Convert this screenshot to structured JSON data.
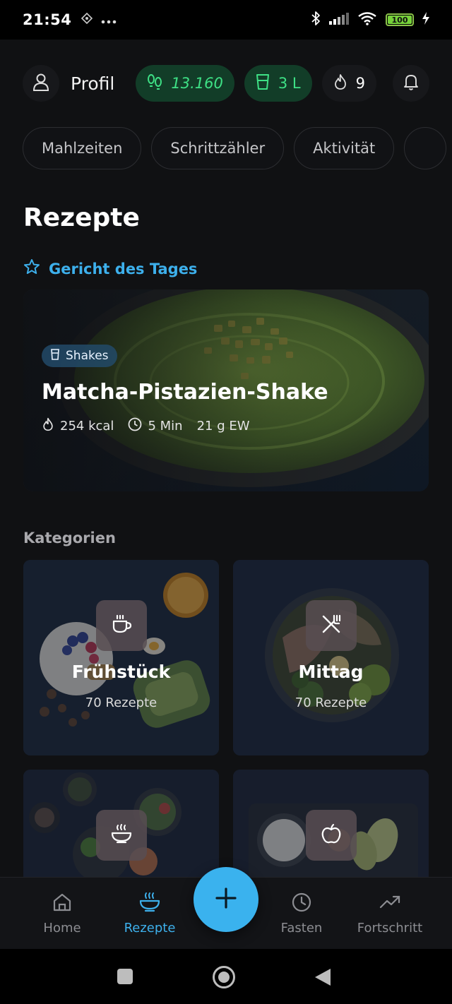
{
  "status_bar": {
    "time": "21:54",
    "battery_level": "100",
    "battery_fraction": 1.0
  },
  "header": {
    "profile_label": "Profil",
    "steps_value": "13.160",
    "water_value": "3 L",
    "streak_value": "9"
  },
  "chips": [
    {
      "label": "Mahlzeiten"
    },
    {
      "label": "Schrittzähler"
    },
    {
      "label": "Aktivität"
    }
  ],
  "page_title": "Rezepte",
  "dish_of_day": {
    "section_label": "Gericht des Tages",
    "tag": "Shakes",
    "title": "Matcha-Pistazien-Shake",
    "kcal": "254 kcal",
    "time": "5 Min",
    "protein": "21 g EW"
  },
  "categories_label": "Kategorien",
  "categories": [
    {
      "name": "Frühstück",
      "count": "70 Rezepte",
      "icon": "coffee-cup-icon"
    },
    {
      "name": "Mittag",
      "count": "70 Rezepte",
      "icon": "fork-knife-icon"
    },
    {
      "name": "",
      "count": "",
      "icon": "soup-bowl-icon"
    },
    {
      "name": "",
      "count": "",
      "icon": "apple-icon"
    }
  ],
  "bottom_nav": {
    "home": "Home",
    "recipes": "Rezepte",
    "fasting": "Fasten",
    "progress": "Fortschritt"
  },
  "colors": {
    "accent": "#3db0ec",
    "green_pill_bg": "#123d28",
    "green_text": "#3ee085",
    "background": "#101113"
  }
}
